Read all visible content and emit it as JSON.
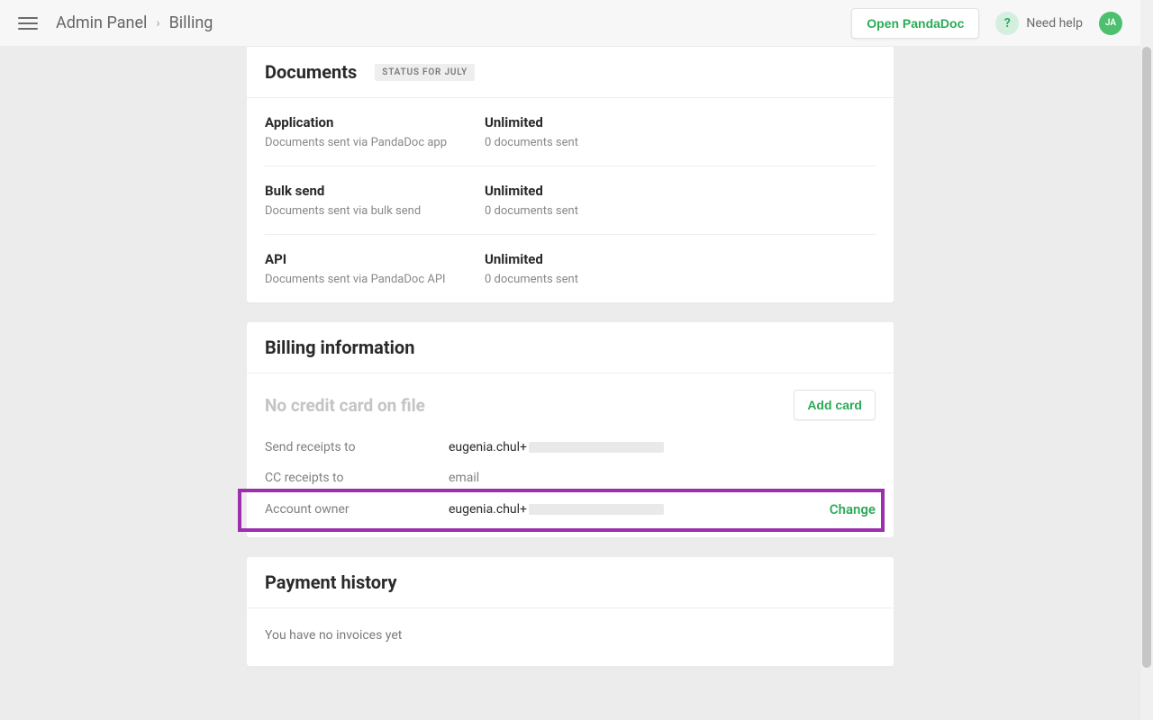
{
  "header": {
    "breadcrumb": [
      "Admin Panel",
      "Billing"
    ],
    "open_btn": "Open PandaDoc",
    "help_label": "Need help",
    "avatar_initials": "JA"
  },
  "documents_card": {
    "title": "Documents",
    "badge": "STATUS FOR JULY",
    "rows": [
      {
        "label": "Application",
        "sub": "Documents sent via PandaDoc app",
        "limit": "Unlimited",
        "count": "0 documents sent"
      },
      {
        "label": "Bulk send",
        "sub": "Documents sent via bulk send",
        "limit": "Unlimited",
        "count": "0 documents sent"
      },
      {
        "label": "API",
        "sub": "Documents sent via PandaDoc API",
        "limit": "Unlimited",
        "count": "0 documents sent"
      }
    ]
  },
  "billing_card": {
    "title": "Billing information",
    "no_card_text": "No credit card on file",
    "add_card_btn": "Add card",
    "send_receipts_label": "Send receipts to",
    "send_receipts_value": "eugenia.chul+",
    "cc_receipts_label": "CC receipts to",
    "cc_receipts_value": "email",
    "account_owner_label": "Account owner",
    "account_owner_value": "eugenia.chul+",
    "change_btn": "Change"
  },
  "payment_card": {
    "title": "Payment history",
    "empty_text": "You have no invoices yet"
  }
}
